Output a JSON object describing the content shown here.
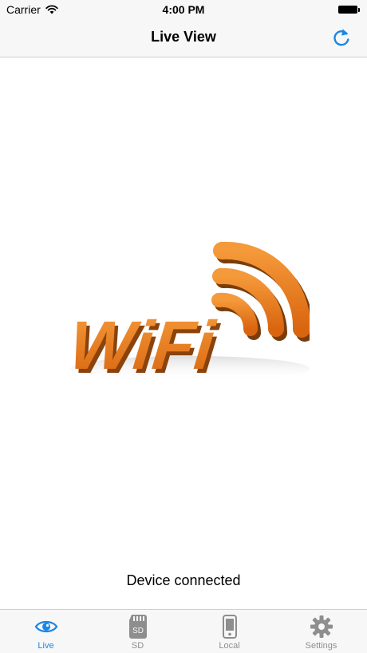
{
  "status_bar": {
    "carrier": "Carrier",
    "time": "4:00 PM"
  },
  "nav": {
    "title": "Live View",
    "refresh_icon": "refresh-icon"
  },
  "content": {
    "image_text": "WiFi",
    "status_text": "Device connected"
  },
  "tabs": [
    {
      "label": "Live",
      "icon": "eye-icon",
      "active": true
    },
    {
      "label": "SD",
      "icon": "sd-card-icon",
      "active": false
    },
    {
      "label": "Local",
      "icon": "phone-icon",
      "active": false
    },
    {
      "label": "Settings",
      "icon": "gear-icon",
      "active": false
    }
  ],
  "colors": {
    "accent": "#1a87e6",
    "inactive": "#8e8e8e",
    "bar_background": "#f7f7f7",
    "wifi_orange": "#e8731b"
  }
}
